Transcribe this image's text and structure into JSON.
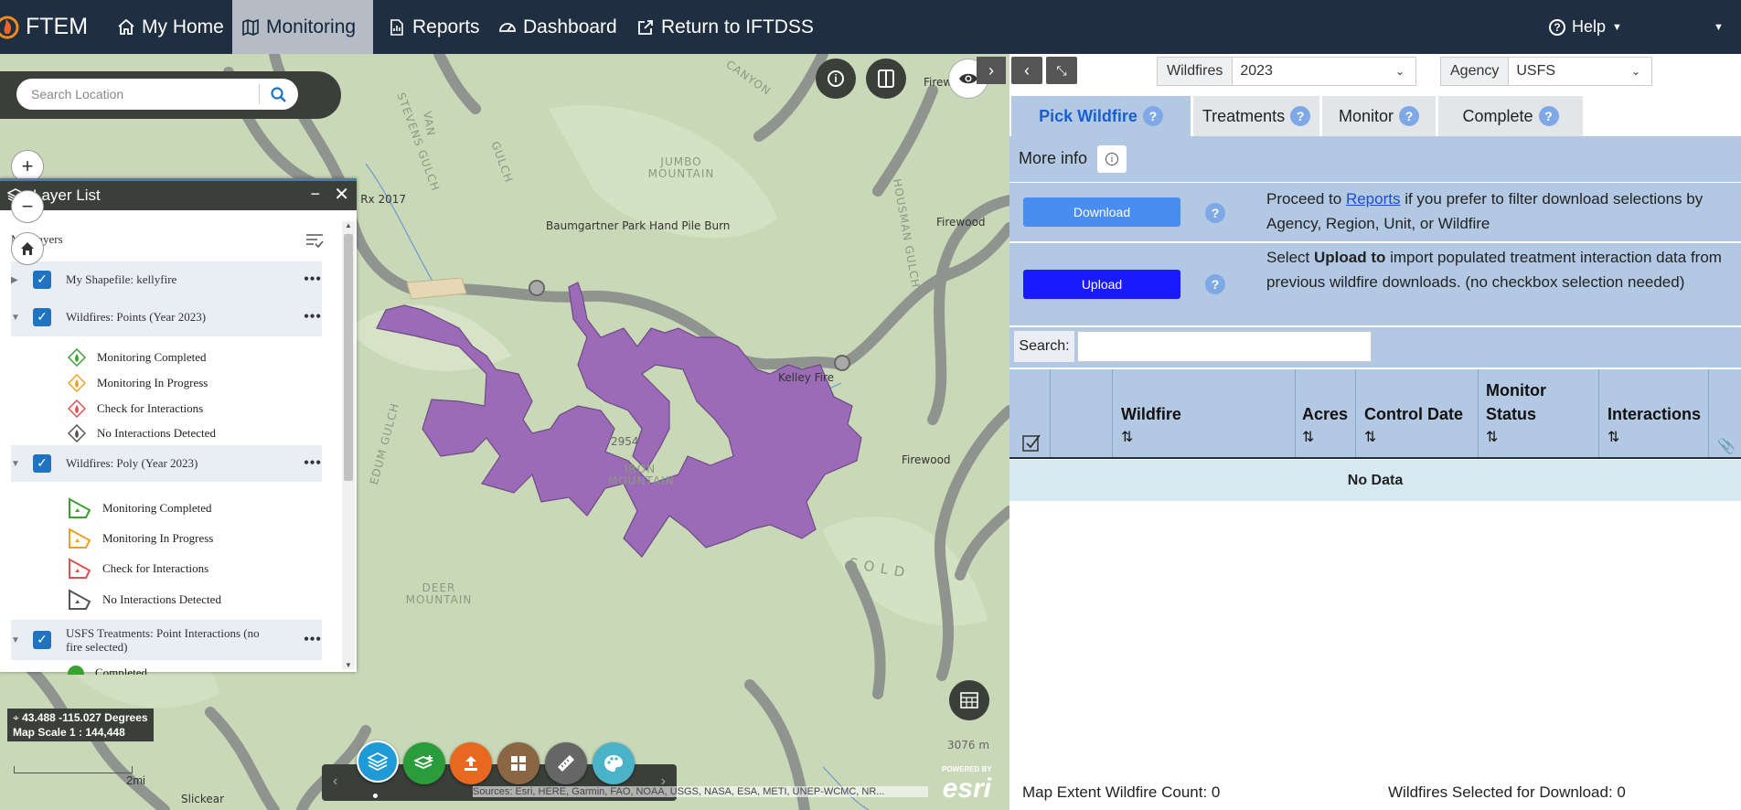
{
  "nav": {
    "brand": "FTEM",
    "items": [
      {
        "label": "My Home",
        "icon": "home-icon"
      },
      {
        "label": "Monitoring",
        "icon": "map-icon"
      },
      {
        "label": "Reports",
        "icon": "report-icon"
      },
      {
        "label": "Dashboard",
        "icon": "dashboard-icon"
      },
      {
        "label": "Return to IFTDSS",
        "icon": "external-link-icon"
      }
    ],
    "help_label": "Help"
  },
  "map": {
    "search_placeholder": "Search Location",
    "labels": {
      "baumgartner": "Baumgartner Park Hand Pile Burn",
      "kelley": "Kelley Fire",
      "rx2017": "e Rx 2017",
      "fire_top": "Firew",
      "firewood_right": "Firewood",
      "firewood_bottom": "Firewood",
      "elev_2954": "2954",
      "elev_3076": "3076 m",
      "slickear": "Slickear",
      "jumbo": "JUMBO MOUNTAIN",
      "iron": "IRON MOUNTAIN",
      "deer": "DEER MOUNTAIN",
      "canyon": "CANYON",
      "stevens": "STEVENS GULCH",
      "van": "VAN",
      "gulch": "GULCH",
      "solo": "S O L D",
      "housman": "HOUSMAN GULCH",
      "edum": "EDUM GULCH"
    },
    "coords": "43.488 -115.027 Degrees",
    "scale": "Map Scale 1 : 144,448",
    "scalebar_label": "2mi",
    "attribution": "Sources: Esri, HERE, Garmin, FAO, NOAA, USGS, NASA, ESA, METI, UNEP-WCMC, NR...",
    "esri_powered": "POWERED BY",
    "esri": "esri"
  },
  "layer_list": {
    "title": "Layer List",
    "my_layers": "My Layers",
    "groups": [
      {
        "label": "My Shapefile: kellyfire",
        "checked": true
      },
      {
        "label": "Wildfires: Points (Year 2023)",
        "checked": true
      },
      {
        "label": "Wildfires: Poly (Year 2023)",
        "checked": true
      },
      {
        "label": "USFS Treatments: Point Interactions (no fire selected)",
        "checked": true
      }
    ],
    "points_legend": [
      "Monitoring Completed",
      "Monitoring In Progress",
      "Check for Interactions",
      "No Interactions Detected"
    ],
    "poly_legend": [
      "Monitoring Completed",
      "Monitoring In Progress",
      "Check for Interactions",
      "No Interactions Detected"
    ],
    "treatments_legend": [
      "Completed"
    ]
  },
  "panel": {
    "wildfires_label": "Wildfires",
    "year": "2023",
    "agency_label": "Agency",
    "agency": "USFS",
    "tabs": [
      "Pick Wildfire",
      "Treatments",
      "Monitor",
      "Complete"
    ],
    "more_info": "More info",
    "download_label": "Download",
    "upload_label": "Upload",
    "download_desc_pre": "Proceed to ",
    "download_desc_link": "Reports",
    "download_desc_post": " if you prefer to filter download selections by Agency, Region, Unit, or Wildfire",
    "upload_desc_pre": "Select ",
    "upload_desc_bold": "Upload to",
    "upload_desc_post": " import populated treatment interaction data from previous wildfire downloads. (no checkbox selection needed)",
    "search_label": "Search:",
    "columns": [
      "Wildfire",
      "Acres",
      "Control Date",
      "Monitor Status",
      "Interactions"
    ],
    "no_data": "No Data",
    "count_label": "Map Extent Wildfire Count: 0",
    "selected_label": "Wildfires Selected for Download: 0"
  },
  "colors": {
    "nav_bg": "#1f2f41",
    "fire_poly": "#9c6bb8",
    "accent_blue": "#1f73c0",
    "upload_blue": "#1a1aff"
  }
}
